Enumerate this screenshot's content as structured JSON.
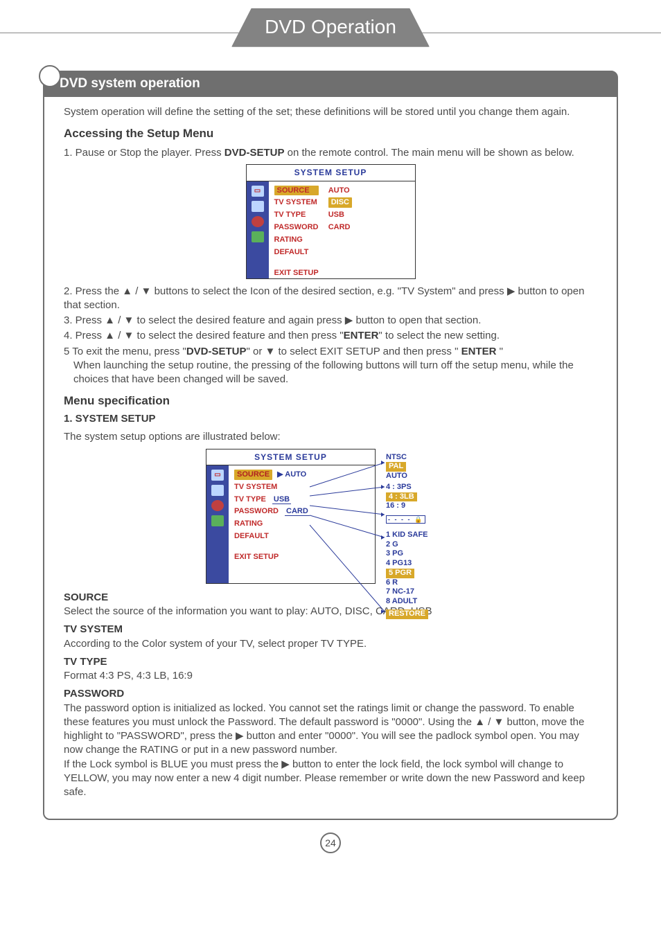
{
  "page": {
    "title": "DVD Operation",
    "number": "24"
  },
  "section": {
    "heading": "DVD system operation",
    "intro": "System operation will define the setting of the set; these definitions will be stored until you change them again."
  },
  "accessing": {
    "heading": "Accessing the Setup Menu",
    "step1_pre": "1. Pause or Stop the player. Press ",
    "step1_bold": "DVD-SETUP",
    "step1_post": " on the remote control. The main menu will be shown as below.",
    "step2": "2. Press the  ▲ / ▼  buttons to select the Icon of the desired section, e.g. \"TV System\" and press  ▶ button to open that section.",
    "step3": "3. Press ▲ / ▼ to select the desired feature and again press  ▶  button to open that section.",
    "step4_pre": "4. Press ▲ /  ▼ to select the desired feature and then press \"",
    "step4_bold": "ENTER",
    "step4_post": "\" to select the new setting.",
    "step5_a": "5  To exit the menu, press \"",
    "step5_b": "DVD-SETUP",
    "step5_c": "\" or  ▼  to select EXIT SETUP and then press \" ",
    "step5_d": "ENTER",
    "step5_e": " \"",
    "step5_f": "When launching the setup routine, the pressing of the following buttons will turn off the setup menu, while the choices that have been changed will be saved."
  },
  "osd": {
    "title": "SYSTEM SETUP",
    "items": [
      "SOURCE",
      "TV SYSTEM",
      "TV TYPE",
      "PASSWORD",
      "RATING",
      "DEFAULT"
    ],
    "exit": "EXIT SETUP",
    "right": [
      "AUTO",
      "DISC",
      "USB",
      "CARD"
    ],
    "right_sel_index": 1
  },
  "menuspec": {
    "heading": "Menu specification",
    "sub1": "1. SYSTEM SETUP",
    "sub1_text": "The system setup options are illustrated below:"
  },
  "osd2_side": {
    "tvsystem": [
      "NTSC",
      "PAL",
      "AUTO"
    ],
    "tvtype": [
      "4 : 3PS",
      "4 : 3LB",
      "16 : 9"
    ],
    "password": "- - - -  🔒",
    "rating": [
      "1 KID SAFE",
      "2 G",
      "3 PG",
      "4 PG13",
      "5 PGR",
      "6 R",
      "7 NC-17",
      "8 ADULT"
    ],
    "rating_sel_index": 4,
    "tvtype_sel_index": 1,
    "tvsystem_sel_index": 1,
    "restore": "RESTORE"
  },
  "defs": {
    "source_h": "SOURCE",
    "source_t": "Select the source of the information you want to play: AUTO, DISC, CARD, USB",
    "tvsystem_h": "TV SYSTEM",
    "tvsystem_t": "According to the Color system of your TV, select proper TV TYPE.",
    "tvtype_h": "TV TYPE",
    "tvtype_t": "Format 4:3 PS, 4:3 LB, 16:9",
    "password_h": "PASSWORD",
    "password_t1": "The password option is initialized as locked. You cannot set the ratings limit or change the password. To enable these features you must unlock the Password. The default password is \"0000\". Using the ▲ / ▼ button, move the highlight to \"PASSWORD\", press the  ▶  button and enter \"0000\". You will see the padlock symbol open. You may now change the RATING or put in a new password number.",
    "password_t2": "If the Lock symbol is BLUE you must press the  ▶  button to enter the lock field, the lock symbol will change to YELLOW, you may now enter a new 4 digit number. Please remember or write down the new Password and keep safe."
  }
}
